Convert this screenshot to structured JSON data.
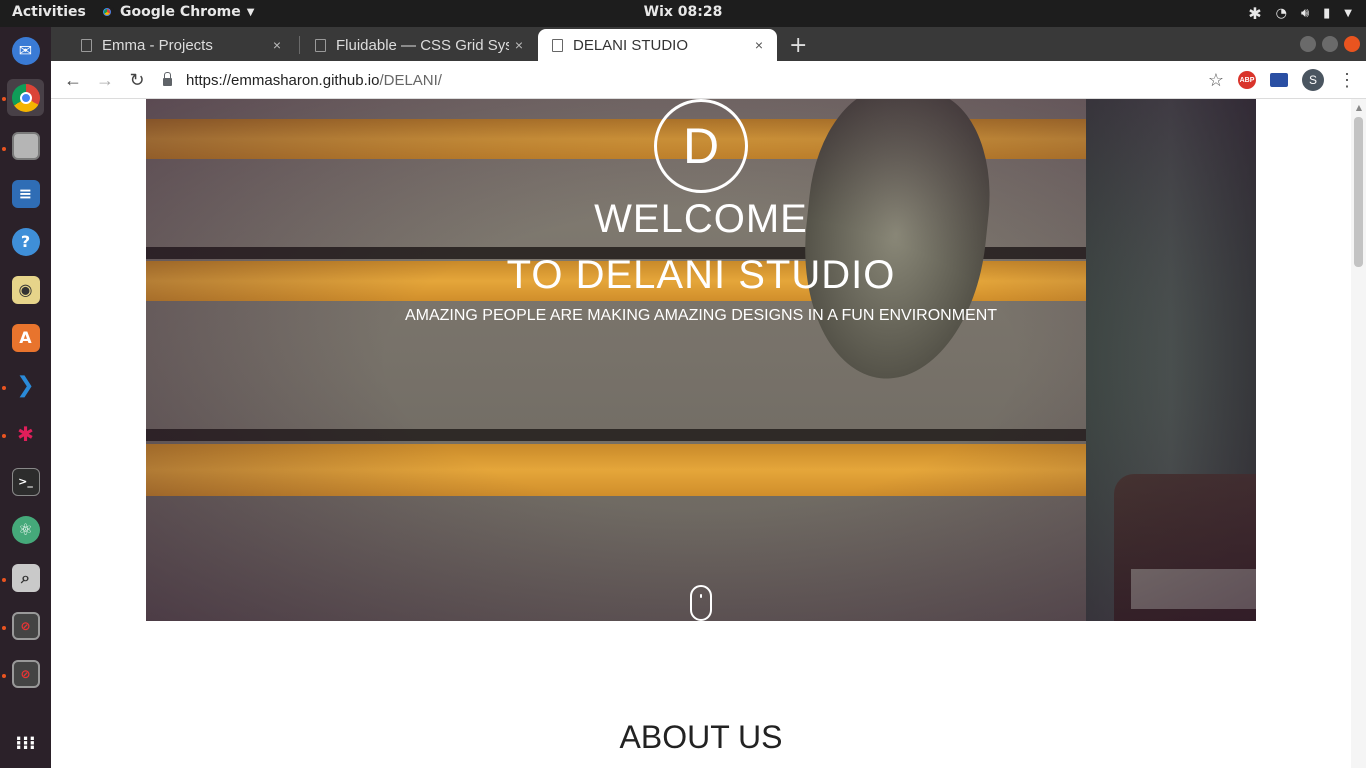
{
  "topbar": {
    "activities": "Activities",
    "app_name": "Google Chrome",
    "clock": "Wix 08:28"
  },
  "dock": {
    "items": [
      {
        "name": "thunderbird",
        "color": "#3a7bd5"
      },
      {
        "name": "chrome",
        "color": "#e0b030"
      },
      {
        "name": "files",
        "color": "#9b9b9b"
      },
      {
        "name": "writer",
        "color": "#2f6db5"
      },
      {
        "name": "help",
        "color": "#3f8fd8"
      },
      {
        "name": "rhythmbox",
        "color": "#e6d48a"
      },
      {
        "name": "software",
        "color": "#e8742d"
      },
      {
        "name": "vscode",
        "color": "#2a8ad8"
      },
      {
        "name": "slack",
        "color": "#4a154b"
      },
      {
        "name": "terminal",
        "color": "#2c2c2c"
      },
      {
        "name": "atom",
        "color": "#45a97a"
      },
      {
        "name": "screenshot",
        "color": "#c9c9c9"
      },
      {
        "name": "app-1",
        "color": "#8a2a2a"
      },
      {
        "name": "app-2",
        "color": "#8a2a2a"
      },
      {
        "name": "show-apps",
        "color": "#ffffff"
      }
    ]
  },
  "browser": {
    "tabs": [
      {
        "title": "Emma - Projects",
        "active": false
      },
      {
        "title": "Fluidable — CSS Grid Syst",
        "active": false
      },
      {
        "title": "DELANI STUDIO",
        "active": true
      }
    ],
    "new_tab": "+",
    "close_glyph": "×",
    "url_host": "https://emmasharon.github.io",
    "url_path": "/DELANI/",
    "profile_initial": "S",
    "abp_label": "ABP"
  },
  "page": {
    "logo_letter": "D",
    "welcome": "WELCOME",
    "studio": "TO DELANI STUDIO",
    "tagline": "AMAZING PEOPLE ARE MAKING AMAZING DESIGNS IN A FUN ENVIRONMENT",
    "about_heading": "ABOUT US"
  },
  "colors": {
    "accent_orange": "#e95420",
    "stair_yellow": "#e5a63a"
  }
}
